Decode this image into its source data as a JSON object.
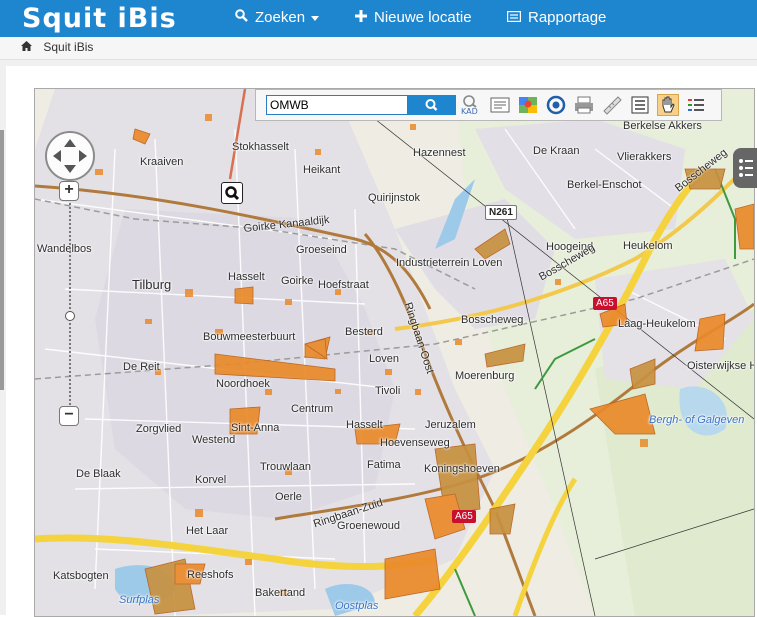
{
  "brand": "Squit iBis",
  "nav": [
    {
      "label": "Zoeken",
      "icon": "search-icon"
    },
    {
      "label": "Nieuwe locatie",
      "icon": "plus-icon"
    },
    {
      "label": "Rapportage",
      "icon": "report-icon"
    }
  ],
  "breadcrumb": {
    "home_icon": "home-icon",
    "label": "Squit iBis"
  },
  "toolbar": {
    "search_value": "OMWB",
    "tools": [
      "kadaster-search-icon",
      "info-list-icon",
      "google-maps-icon",
      "target-icon",
      "print-icon",
      "measure-ruler-icon",
      "legend-list-icon",
      "pan-hand-icon",
      "layers-list-icon"
    ],
    "kad_label": "KAD"
  },
  "map": {
    "places": [
      "Stokhasselt",
      "Kraaiven",
      "Heikant",
      "Quirijnstok",
      "Hazennest",
      "De Kraan",
      "Vlierakkers",
      "Berkelse Akkers",
      "Berkel-Enschot",
      "Groeseind",
      "Hoogeind",
      "Heukelom",
      "Wandelbos",
      "Tilburg",
      "Hasselt",
      "Goirke",
      "Hoefstraat",
      "Industrieterrein Loven",
      "Bosscheweg",
      "Laag-Heukelom",
      "Bouwmeesterbuurt",
      "Besterd",
      "Loven",
      "De Reit",
      "Noordhoek",
      "Tivoli",
      "Moerenburg",
      "Oisterwijkse Hoeve",
      "Centrum",
      "Zorgvlied",
      "Sint-Anna",
      "Westend",
      "Hasselt",
      "Jeruzalem",
      "Hoevenseweg",
      "Fatima",
      "Koningshoeven",
      "De Blaak",
      "Korvel",
      "Trouwlaan",
      "Oerle",
      "Het Laar",
      "Groenewoud",
      "Katsbogten",
      "Reeshofs",
      "Bakertand"
    ],
    "roads": [
      "Goirke Kanaaldijk",
      "Ringbaan-Oost",
      "Ringbaan-Zuid",
      "Bosscheweg",
      "Bosscheweg"
    ],
    "waters": [
      "Bergh- of Galgeven",
      "Surfplas",
      "Oostplas"
    ],
    "shields": [
      "N261",
      "A65",
      "A65"
    ]
  }
}
